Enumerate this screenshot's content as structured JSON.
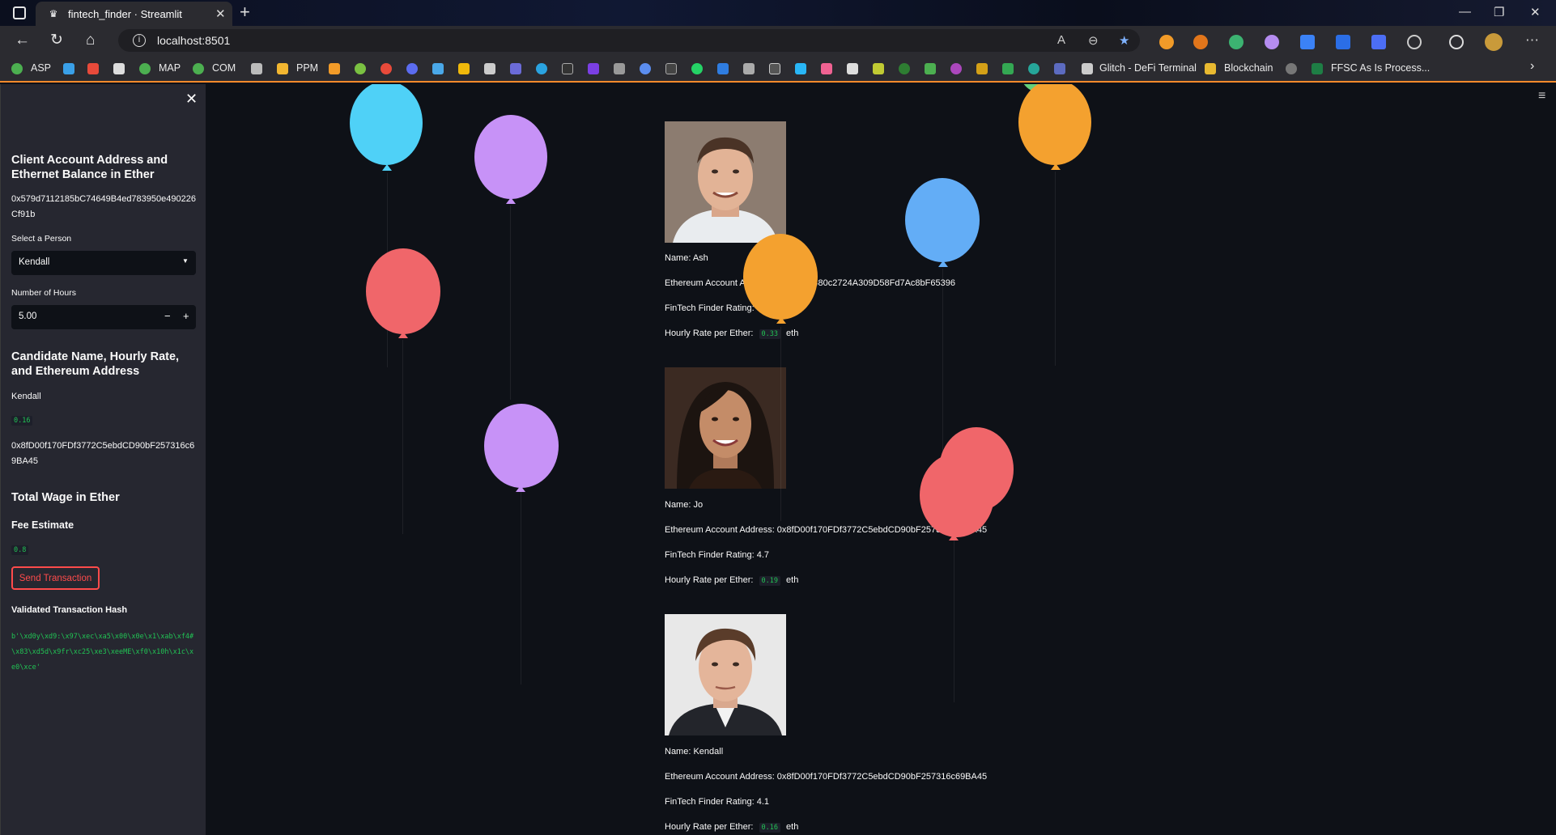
{
  "browser": {
    "tab_title": "fintech_finder · Streamlit",
    "url": "localhost:8501",
    "bookmarks": [
      "ASP",
      "MAP",
      "COM",
      "PPM",
      "Glitch - DeFi Terminal",
      "Blockchain",
      "FFSC As Is Process..."
    ]
  },
  "sidebar": {
    "account_heading": "Client Account Address and Ethernet Balance in Ether",
    "account_address": "0x579d7112185bC74649B4ed783950e490226Cf91b",
    "select_label": "Select a Person",
    "select_value": "Kendall",
    "hours_label": "Number of Hours",
    "hours_value": "5.00",
    "candidate_heading": "Candidate Name, Hourly Rate, and Ethereum Address",
    "candidate_name": "Kendall",
    "candidate_rate": "0.16",
    "candidate_address": "0x8fD00f170FDf3772C5ebdCD90bF257316c69BA45",
    "wage_heading": "Total Wage in Ether",
    "fee_heading": "Fee Estimate",
    "fee_value": "0.8",
    "send_label": "Send Transaction",
    "hash_heading": "Validated Transaction Hash",
    "hash_value": "b'\\xd0y\\xd9:\\x97\\xec\\xa5\\x00\\x0e\\x1\\xab\\xf4#\\x83\\xd5d\\x9fr\\xc25\\xe3\\xeeME\\xf0\\x10h\\x1c\\xe0\\xce'"
  },
  "candidates": [
    {
      "name_line": "Name: Ash",
      "address_line": "Ethereum Account Address: 0x8F9C4480c2724A309D58Fd7Ac8bF65396",
      "rating_line": "FinTech Finder Rating: 5.0",
      "rate_label": "Hourly Rate per Ether:",
      "rate_value": "0.33",
      "rate_unit": "eth"
    },
    {
      "name_line": "Name: Jo",
      "address_line": "Ethereum Account Address: 0x8fD00f170FDf3772C5ebdCD90bF257316c69BA45",
      "rating_line": "FinTech Finder Rating: 4.7",
      "rate_label": "Hourly Rate per Ether:",
      "rate_value": "0.19",
      "rate_unit": "eth"
    },
    {
      "name_line": "Name: Kendall",
      "address_line": "Ethereum Account Address: 0x8fD00f170FDf3772C5ebdCD90bF257316c69BA45",
      "rating_line": "FinTech Finder Rating: 4.1",
      "rate_label": "Hourly Rate per Ether:",
      "rate_value": "0.16",
      "rate_unit": "eth"
    }
  ],
  "balloon_colors": {
    "cyan": "#4fd1f7",
    "purple": "#c792f7",
    "red": "#f0666a",
    "orange": "#f4a12f",
    "blue": "#63adf6",
    "green": "#63d07a"
  },
  "accent": "#ff4b4b"
}
